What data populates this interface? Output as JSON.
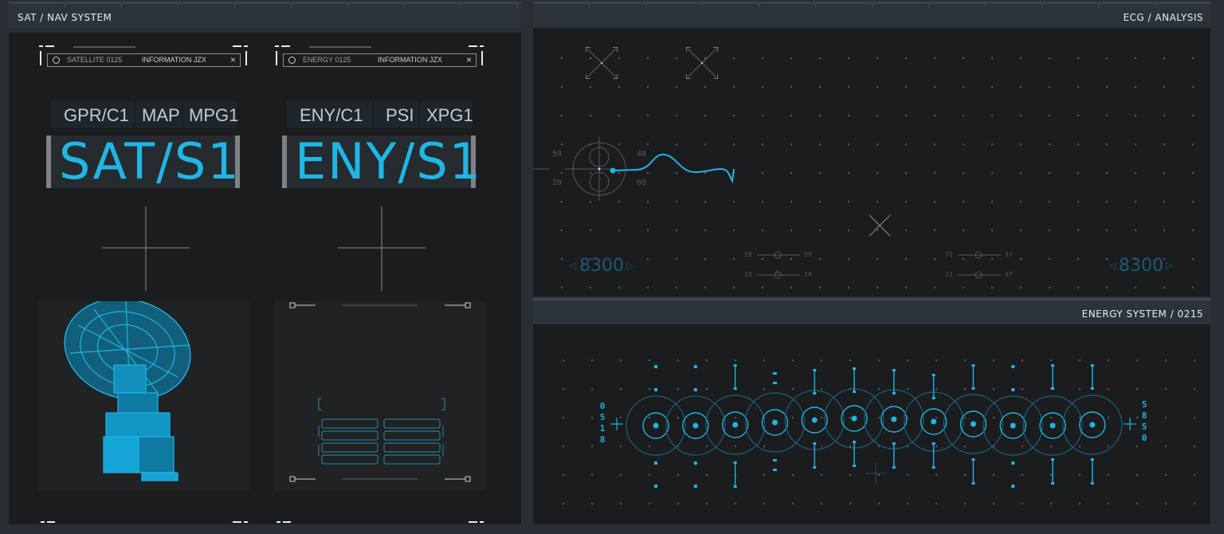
{
  "left_panel": {
    "title": "SAT / NAV SYSTEM",
    "cards": [
      {
        "info_label": "SATELLITE 0125",
        "info_value": "INFORMATION JZX",
        "close": "×",
        "codes": [
          "GPR/C1",
          "MAP",
          "MPG1"
        ],
        "main_code": "SAT/S1"
      },
      {
        "info_label": "ENERGY 0125",
        "info_value": "INFORMATION JZX",
        "close": "×",
        "codes": [
          "ENY/C1",
          "PSI",
          "XPG1"
        ],
        "main_code": "ENY/S1"
      }
    ]
  },
  "ecg_panel": {
    "title": "ECG / ANALYSIS",
    "gauge_labels": {
      "tl": "50",
      "tr": "48",
      "bl": "20",
      "br": "08"
    },
    "readout_left": "8300",
    "readout_right": "8300",
    "slider_group_1": {
      "top_left": "59",
      "top_right": "59",
      "bottom_left": "19",
      "bottom_right": "19"
    },
    "slider_group_2": {
      "top_left": "71",
      "top_right": "37",
      "bottom_left": "31",
      "bottom_right": "97"
    }
  },
  "energy_panel": {
    "title": "ENERGY SYSTEM / 0215",
    "left_digits": [
      "0",
      "5",
      "1",
      "8"
    ],
    "right_digits": [
      "5",
      "8",
      "5",
      "0"
    ]
  },
  "colors": {
    "accent": "#1fb6e6",
    "panel_bg": "#1b1c1e",
    "header_bg": "#2b333b"
  }
}
